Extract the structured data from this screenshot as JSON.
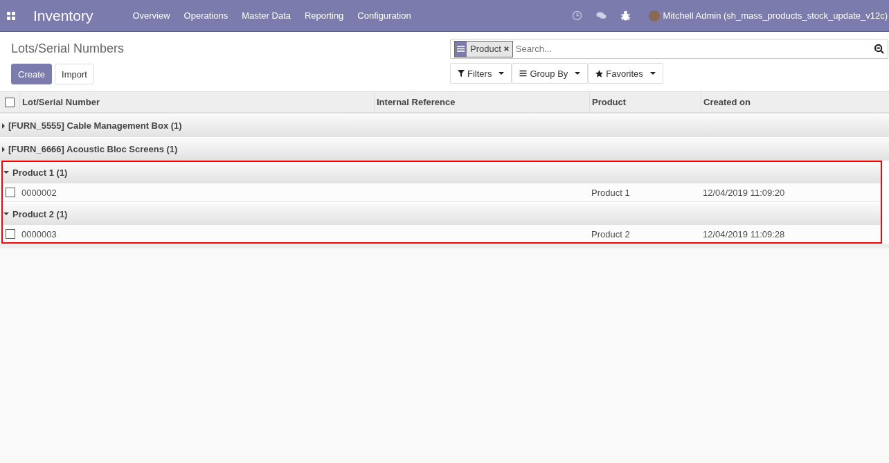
{
  "navbar": {
    "app_name": "Inventory",
    "menu": [
      "Overview",
      "Operations",
      "Master Data",
      "Reporting",
      "Configuration"
    ],
    "user": "Mitchell Admin (sh_mass_products_stock_update_v12c)"
  },
  "control_panel": {
    "breadcrumb": "Lots/Serial Numbers",
    "buttons": [
      {
        "label": "Create",
        "kind": "primary"
      },
      {
        "label": "Import",
        "kind": "secondary"
      }
    ],
    "search": {
      "facets": [
        {
          "value": "Product"
        }
      ],
      "placeholder": "Search..."
    },
    "dropdowns": [
      {
        "label": "Filters",
        "kind": "filter"
      },
      {
        "label": "Group By",
        "kind": "group"
      },
      {
        "label": "Favorites",
        "kind": "star"
      }
    ]
  },
  "table": {
    "select_all_checked": false,
    "columns": [
      "Lot/Serial Number",
      "Internal Reference",
      "Product",
      "Created on"
    ],
    "sections": [
      {
        "highlighted": false,
        "groups": [
          {
            "label": "[FURN_5555] Cable Management Box (1)",
            "expanded": false
          },
          {
            "label": "[FURN_6666] Acoustic Bloc Screens (1)",
            "expanded": false
          }
        ]
      },
      {
        "highlighted": true,
        "groups": [
          {
            "label": "Product 1 (1)",
            "expanded": true,
            "rows": [
              {
                "checked": false,
                "cells": [
                  "0000002",
                  "",
                  "Product 1",
                  "12/04/2019 11:09:20"
                ]
              }
            ]
          },
          {
            "label": "Product 2 (1)",
            "expanded": true,
            "rows": [
              {
                "checked": false,
                "cells": [
                  "0000003",
                  "",
                  "Product 2",
                  "12/04/2019 11:09:28"
                ]
              }
            ]
          }
        ]
      }
    ]
  }
}
